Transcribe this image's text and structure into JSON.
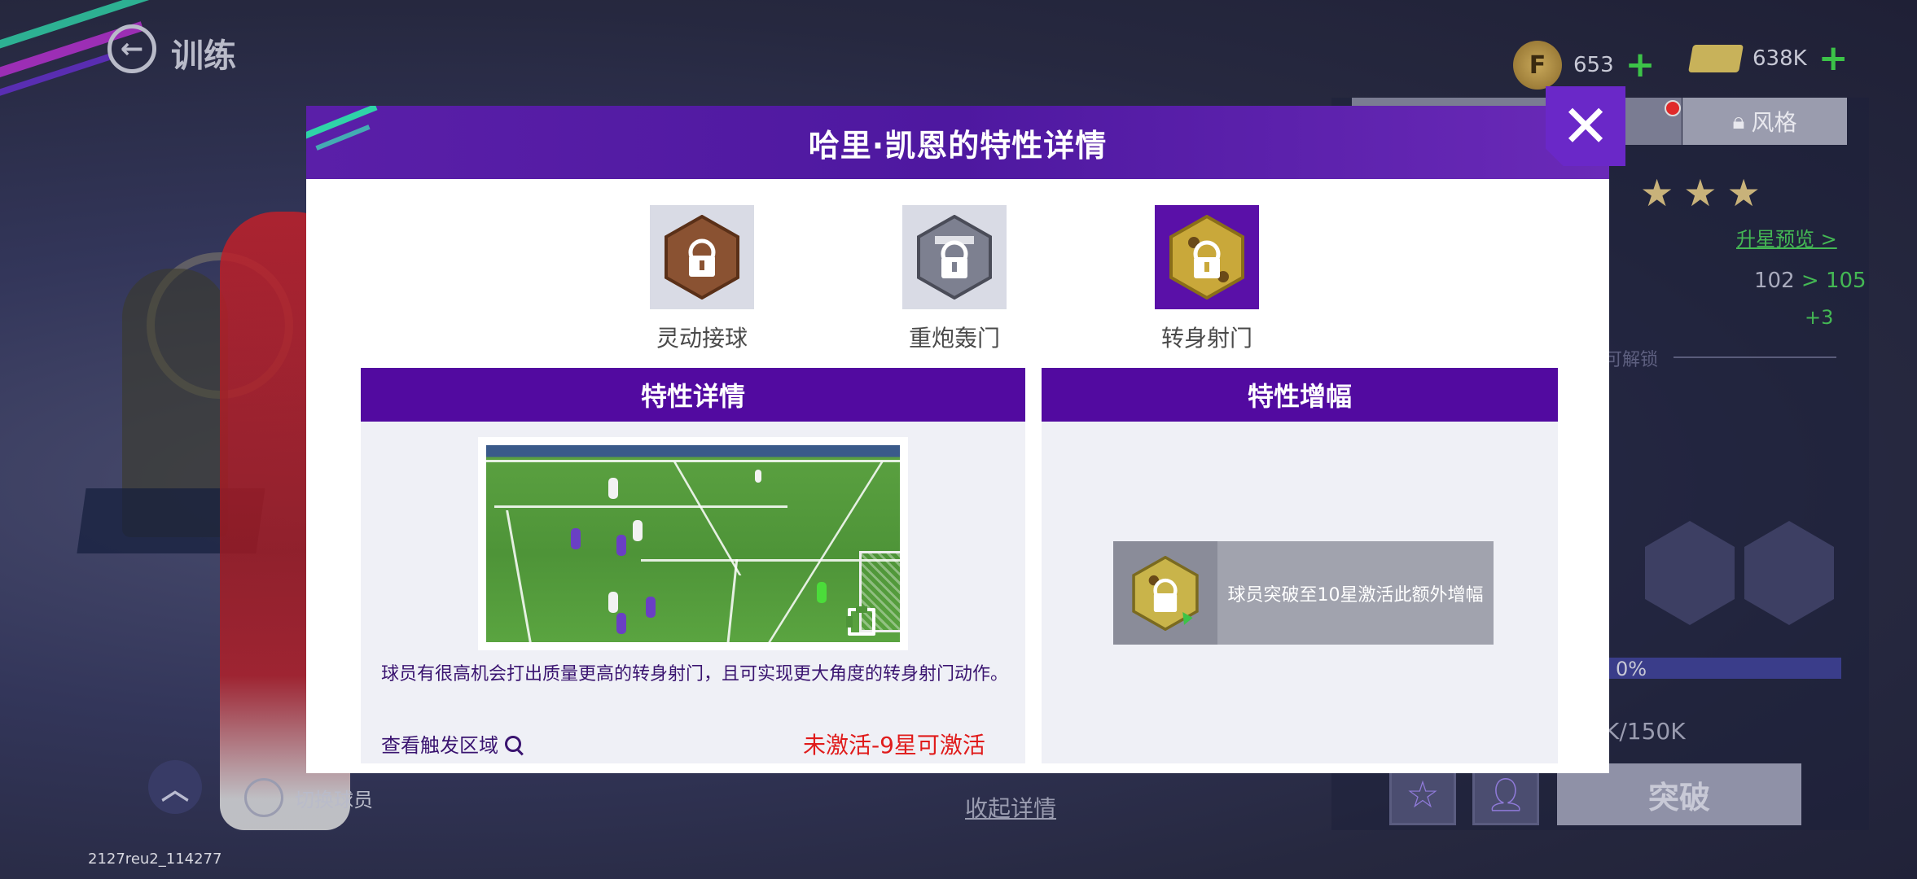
{
  "screen": {
    "page_title": "训练",
    "build_id": "2127reu2_114277"
  },
  "currency": {
    "coins": "653",
    "cash": "638K"
  },
  "player_panel": {
    "style_tab_label": "风格",
    "upgrade_preview_link": "升星预览 >",
    "rating_from": "102",
    "rating_to": "> 105",
    "rating_delta": "+3",
    "unlock_text": "可解锁",
    "progress_percent": "0%",
    "progress_count": "K/150K",
    "breakthrough_button": "突破",
    "collapse_details": "收起详情",
    "switch_player": "切换球员"
  },
  "modal": {
    "title": "哈里·凯恩的特性详情",
    "close_glyph": "✕",
    "traits": [
      {
        "label": "灵动接球",
        "color": "#8a5232",
        "selected": false
      },
      {
        "label": "重炮轰门",
        "color": "#7d8090",
        "selected": false
      },
      {
        "label": "转身射门",
        "color": "#c9a83a",
        "selected": true
      }
    ],
    "details_section": {
      "header": "特性详情",
      "description": "球员有很高机会打出质量更高的转身射门，且可实现更大角度的转身射门动作。",
      "trigger_link": "查看触发区域",
      "status": "未激活-9星可激活"
    },
    "boost_section": {
      "header": "特性增幅",
      "card_text": "球员突破至10星激活此额外增幅"
    }
  },
  "colors": {
    "accent_purple": "#520aa0",
    "header_purple": "#5a1fa8",
    "status_red": "#e01b1b",
    "link_green": "#44b854"
  }
}
